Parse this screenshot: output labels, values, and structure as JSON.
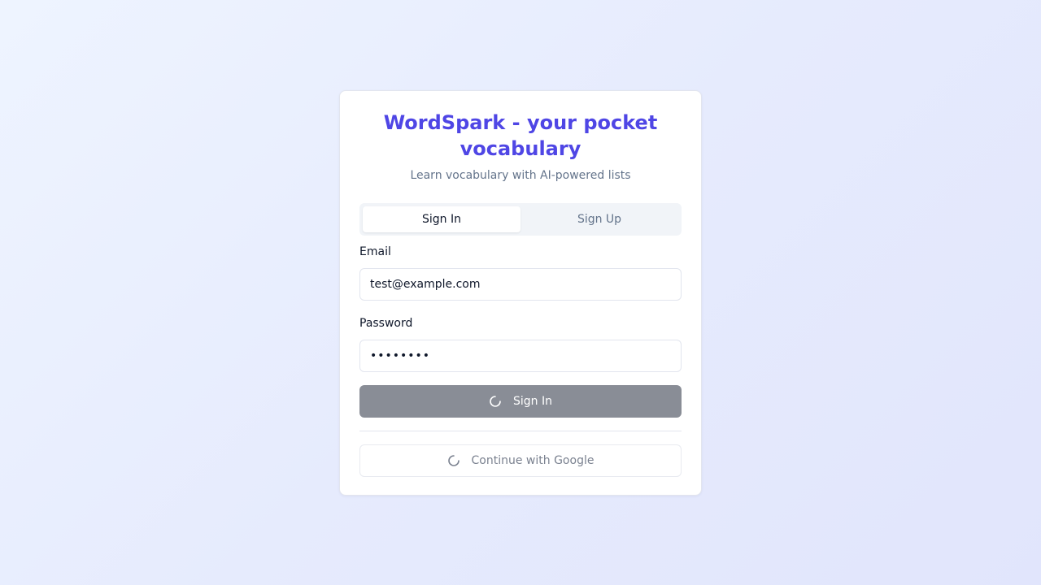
{
  "app": {
    "title": "WordSpark - your pocket vocabulary",
    "subtitle": "Learn vocabulary with AI-powered lists"
  },
  "tabs": [
    {
      "label": "Sign In",
      "active": true
    },
    {
      "label": "Sign Up",
      "active": false
    }
  ],
  "form": {
    "email_label": "Email",
    "email_value": "test@example.com",
    "password_label": "Password",
    "password_value": "••••••••",
    "submit_label": "Sign In",
    "submit_loading": true,
    "google_label": "Continue with Google",
    "google_loading": true
  },
  "colors": {
    "accent": "#4f46e5",
    "submit_disabled": "#898d96"
  },
  "icons": {
    "submit_spinner": "loader-icon",
    "google_spinner": "loader-icon"
  }
}
